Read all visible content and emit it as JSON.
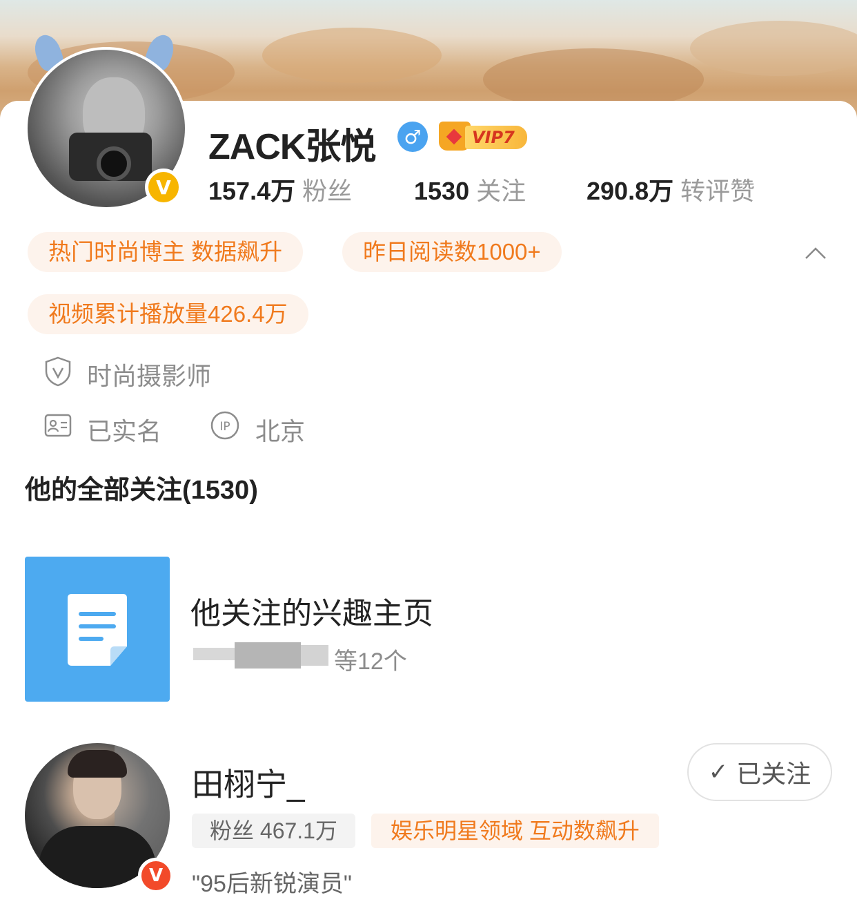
{
  "profile": {
    "name": "ZACK张悦",
    "gender_symbol": "♂",
    "vip_label": "VIP7",
    "verified_mark": "V",
    "stats": {
      "fans_num": "157.4万",
      "fans_label": "粉丝",
      "following_num": "1530",
      "following_label": "关注",
      "likes_num": "290.8万",
      "likes_label": "转评赞"
    },
    "tags": [
      "热门时尚博主 数据飙升",
      "昨日阅读数1000+",
      "视频累计播放量426.4万"
    ],
    "verification": "时尚摄影师",
    "real_name": "已实名",
    "ip_badge": "IP",
    "ip_location": "北京"
  },
  "following_section": {
    "title": "他的全部关注(1530)"
  },
  "interest_pages": {
    "title": "他关注的兴趣主页",
    "count_text": "等12个"
  },
  "follow_items": [
    {
      "name": "田栩宁_",
      "button_label": "已关注",
      "check_glyph": "✓",
      "verified_mark": "V",
      "fans_text": "粉丝 467.1万",
      "tag": "娱乐明星领域 互动数飙升",
      "description": "\"95后新锐演员\""
    }
  ],
  "icons": {
    "shield": "shield-icon",
    "id_card": "id-card-icon",
    "ip": "ip-icon",
    "document": "document-icon",
    "chevron": "chevron-up-icon"
  },
  "colors": {
    "accent_orange": "#f07a1d",
    "tag_bg": "#fdf3ec",
    "interest_blue": "#4daaf0",
    "verified_gold": "#f7b500",
    "verified_red": "#f24a2a"
  }
}
